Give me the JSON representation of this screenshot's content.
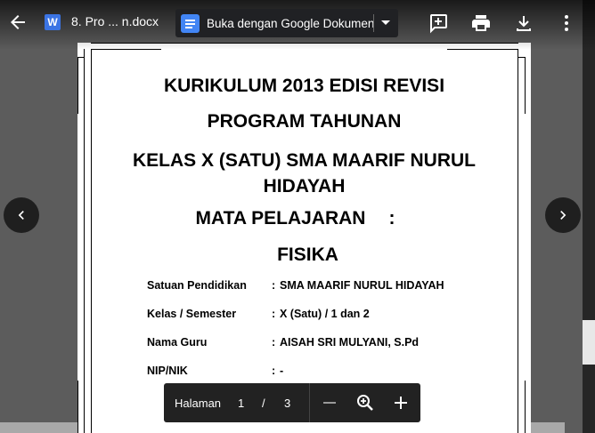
{
  "topbar": {
    "file_icon_letter": "W",
    "file_name": "8. Pro ... n.docx",
    "open_with_label": "Buka dengan Google Dokumen",
    "icons": [
      "back-arrow-icon",
      "word-file-icon",
      "google-docs-icon",
      "dropdown-caret-icon",
      "add-comment-icon",
      "print-icon",
      "download-icon",
      "more-vert-icon"
    ]
  },
  "document": {
    "line1": "KURIKULUM 2013 EDISI REVISI",
    "line2": "PROGRAM TAHUNAN",
    "line3": "KELAS X (SATU) SMA MAARIF NURUL",
    "line3b": "HIDAYAH",
    "line4": "MATA PELAJARAN",
    "line4_colon": ":",
    "line5": "FISIKA",
    "fields": [
      {
        "label": "Satuan Pendidikan",
        "sep": ":",
        "value": "SMA MAARIF NURUL HIDAYAH"
      },
      {
        "label": "Kelas / Semester",
        "sep": ":",
        "value": "X (Satu) / 1 dan 2"
      },
      {
        "label": "Nama Guru",
        "sep": ":",
        "value": "AISAH SRI MULYANI, S.Pd"
      },
      {
        "label": "NIP/NIK",
        "sep": ":",
        "value": "-"
      }
    ]
  },
  "pager": {
    "label": "Halaman",
    "current": "1",
    "slash": "/",
    "total": "3",
    "icons": [
      "zoom-out-icon",
      "zoom-in-icon",
      "plus-icon"
    ]
  },
  "nav": {
    "prev_icon": "chevron-left-icon",
    "next_icon": "chevron-right-icon"
  },
  "colors": {
    "docs_blue": "#4285f4",
    "word_blue": "#3b74e4",
    "toolbar_bg": "#202124",
    "overlay_bg": "#5c5c5c"
  }
}
